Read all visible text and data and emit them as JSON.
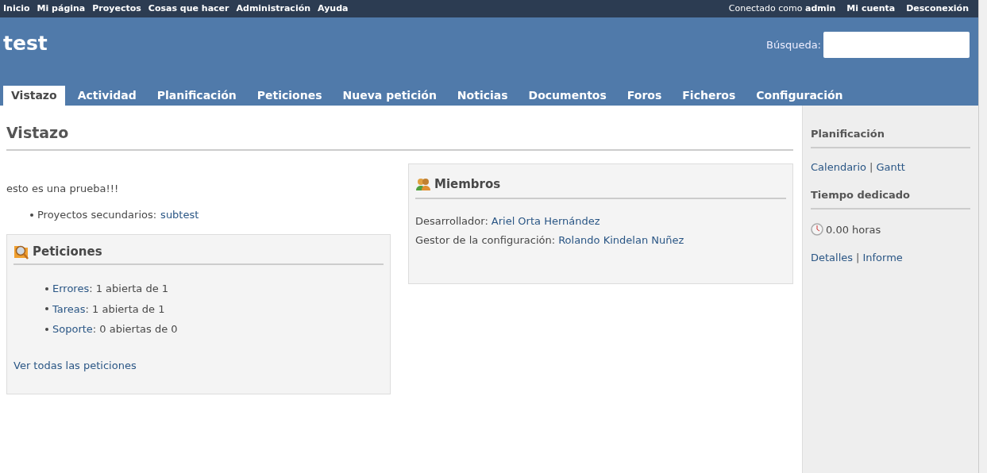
{
  "top_menu": [
    "Inicio",
    "Mi página",
    "Proyectos",
    "Cosas que hacer",
    "Administración",
    "Ayuda"
  ],
  "account": {
    "logged_in": "Conectado como **admin**",
    "links": [
      "Mi cuenta",
      "Desconexión"
    ]
  },
  "header": {
    "title": "test",
    "search_label": "Búsqueda:"
  },
  "tabs": [
    {
      "label": "Vistazo",
      "selected": true
    },
    {
      "label": "Actividad",
      "selected": false
    },
    {
      "label": "Planificación",
      "selected": false
    },
    {
      "label": "Peticiones",
      "selected": false
    },
    {
      "label": "Nueva petición",
      "selected": false
    },
    {
      "label": "Noticias",
      "selected": false
    },
    {
      "label": "Documentos",
      "selected": false
    },
    {
      "label": "Foros",
      "selected": false
    },
    {
      "label": "Ficheros",
      "selected": false
    },
    {
      "label": "Configuración",
      "selected": false
    }
  ],
  "page_title": "Vistazo",
  "description": "esto es una prueba!!!",
  "subprojects": {
    "label": "Proyectos secundarios:",
    "link": "subtest"
  },
  "issues_box": {
    "title": "Peticiones",
    "items": [
      {
        "link": "Errores",
        "text": ": 1 abierta de 1"
      },
      {
        "link": "Tareas",
        "text": ": 1 abierta de 1"
      },
      {
        "link": "Soporte",
        "text": ": 0 abiertas de 0"
      }
    ],
    "view_all": "Ver todas las peticiones"
  },
  "members_box": {
    "title": "Miembros",
    "rows": [
      {
        "role": "Desarrollador:",
        "name": "Ariel Orta Hernández"
      },
      {
        "role": "Gestor de la configuración:",
        "name": "Rolando Kindelan Nuñez"
      }
    ]
  },
  "sidebar": {
    "planning": {
      "title": "Planificación",
      "links": [
        "Calendario",
        "Gantt"
      ],
      "separator": "|"
    },
    "time": {
      "title": "Tiempo dedicado",
      "hours": "0.00 horas",
      "links": [
        "Detalles",
        "Informe"
      ],
      "separator": "|"
    }
  }
}
